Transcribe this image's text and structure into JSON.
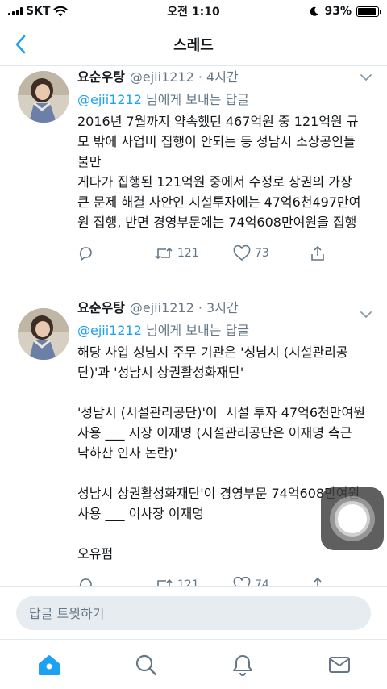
{
  "status_bar": {
    "carrier": "SKT",
    "time": "오전 1:10",
    "battery": "93%",
    "battery_level": 0.93
  },
  "header": {
    "title": "스레드"
  },
  "tweets": [
    {
      "name": "요순우탕",
      "meta": "@ejii1212 · 4시간",
      "reply_handle": "@ejii1212",
      "reply_suffix": " 님에게 보내는 답글",
      "text": "2016년 7월까지 약속했던 467억원 중 121억원 규모 밖에 사업비 집행이 안되는 등 성남시 소상공인들 불만\n게다가 집행된 121억원 중에서 수정로 상권의 가장 큰 문제 해결 사안인 시설투자에는 47억6천497만여원 집행, 반면 경영부문에는 74억608만여원을 집행",
      "retweets": "121",
      "likes": "73"
    },
    {
      "name": "요순우탕",
      "meta": "@ejii1212 · 3시간",
      "reply_handle": "@ejii1212",
      "reply_suffix": " 님에게 보내는 답글",
      "text": "해당 사업 성남시 주무 기관은 '성남시 (시설관리공단)'과 '성남시 상권활성화재단'\n\n'성남시 (시설관리공단)'이  시설 투자 47억6천만여원 사용 ___ 시장 이재명 (시설관리공단은 이재명 측근 낙하산 인사 논란)'\n\n성남시 상권활성화재단'이 경영부문 74억608만여원 사용 ___ 이사장 이재명\n\n오유펌",
      "retweets": "121",
      "likes": "74"
    }
  ],
  "compose": {
    "placeholder": "답글 트윗하기"
  },
  "icons": {
    "back": "chevron-left-icon",
    "caret": "chevron-down-icon",
    "reply": "reply-icon",
    "retweet": "retweet-icon",
    "like": "heart-icon",
    "share": "share-icon",
    "home": "home-icon",
    "search": "search-icon",
    "notifications": "bell-icon",
    "messages": "mail-icon"
  },
  "colors": {
    "accent": "#1da1f2",
    "muted": "#657786",
    "text": "#14171a",
    "divider": "#e1e8ed",
    "compose_bg": "#e6ecf0"
  }
}
